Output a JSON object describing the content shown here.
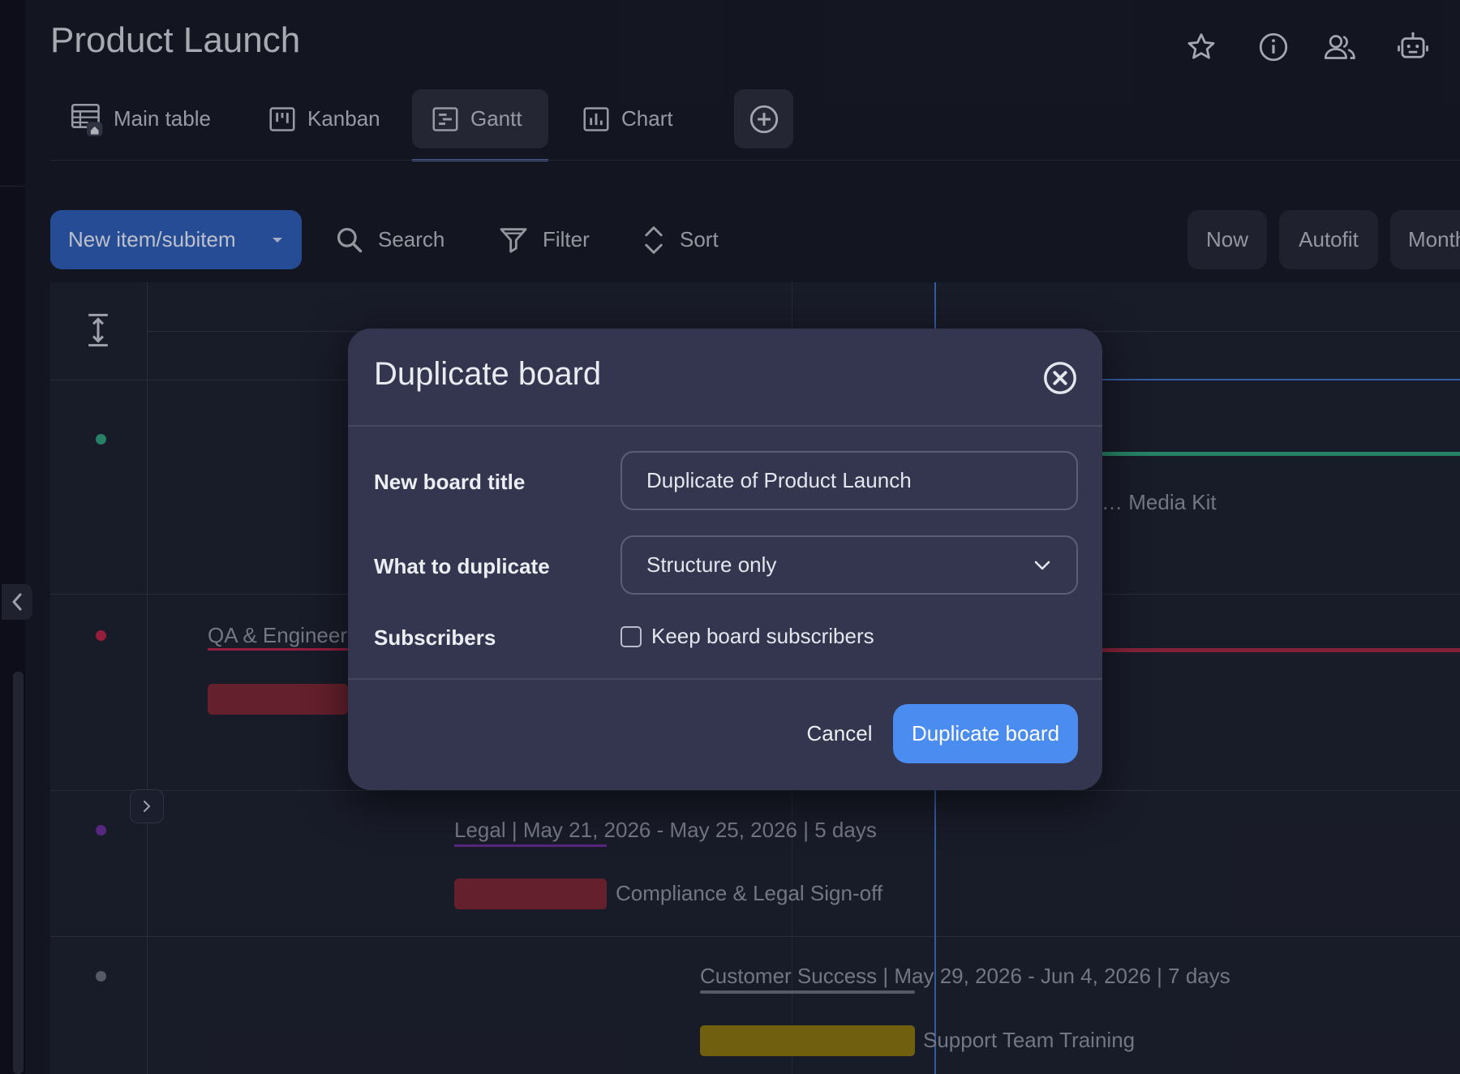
{
  "board": {
    "title": "Product Launch"
  },
  "header_icons": [
    "star-icon",
    "info-icon",
    "members-icon",
    "robot-icon"
  ],
  "tabs": [
    {
      "label": "Main table",
      "icon": "table-icon",
      "active": false
    },
    {
      "label": "Kanban",
      "icon": "kanban-icon",
      "active": false
    },
    {
      "label": "Gantt",
      "icon": "gantt-icon",
      "active": true
    },
    {
      "label": "Chart",
      "icon": "chart-icon",
      "active": false
    }
  ],
  "toolbar": {
    "new_item_label": "New item/subitem",
    "search_label": "Search",
    "filter_label": "Filter",
    "sort_label": "Sort",
    "now_label": "Now",
    "autofit_label": "Autofit",
    "month_label": "Month"
  },
  "gantt": {
    "rows": [
      {
        "dot_color": "#2f9e7c",
        "bar_label": "Media Kit",
        "line_color": "#2f9e7c"
      },
      {
        "dot_color": "#b7254a",
        "group_label": "QA & Engineering",
        "underline_color": "#b7254a",
        "bar_color": "#7a2836",
        "line_color": "#9e2a46"
      },
      {
        "dot_color": "#6b2f9a",
        "group_label": "Legal | May 21, 2026 - May 25, 2026 | 5 days",
        "underline_color": "#6b2f9a",
        "bar_color": "#7a2836",
        "bar_label": "Compliance & Legal Sign-off"
      },
      {
        "dot_color": "#6b6e7c",
        "group_label": "Customer Success | May 29, 2026 - Jun 4, 2026 | 7 days",
        "underline_color": "#6b6e7c",
        "bar_color": "#8a7414",
        "bar_label": "Support Team Training"
      }
    ],
    "today_line_color": "#3f6fc4"
  },
  "modal": {
    "title": "Duplicate board",
    "board_title_label": "New board title",
    "board_title_value": "Duplicate of Product Launch",
    "duplicate_label": "What to duplicate",
    "duplicate_value": "Structure only",
    "subscribers_label": "Subscribers",
    "keep_subscribers_label": "Keep board subscribers",
    "keep_subscribers_checked": false,
    "cancel_label": "Cancel",
    "confirm_label": "Duplicate board"
  },
  "colors": {
    "accent": "#4a8cf0",
    "new_item_button": "#2f5db6",
    "background": "#181b29",
    "modal_background": "#33364e"
  }
}
